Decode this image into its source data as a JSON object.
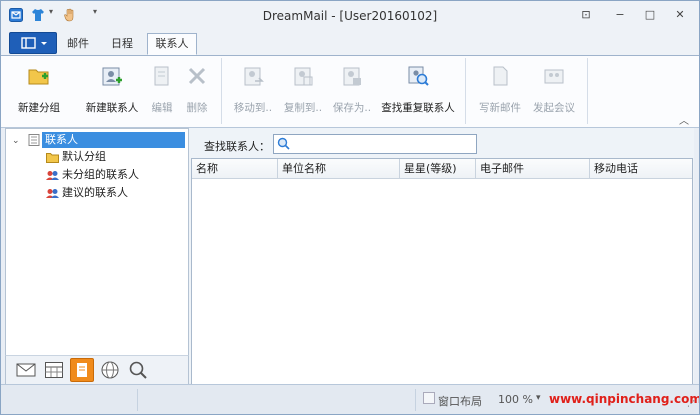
{
  "window": {
    "title": "DreamMail - [User20160102]"
  },
  "tabs": [
    {
      "label": "邮件"
    },
    {
      "label": "日程"
    },
    {
      "label": "联系人"
    }
  ],
  "ribbon": {
    "new_group": "新建分组",
    "new_contact": "新建联系人",
    "edit": "编辑",
    "delete": "删除",
    "move_to": "移动到..",
    "copy_to": "复制到..",
    "save_as": "保存为..",
    "find_duplicates": "查找重复联系人",
    "write_mail": "写新邮件",
    "start_meeting": "发起会议"
  },
  "tree": {
    "root": "联系人",
    "children": [
      {
        "label": "默认分组"
      },
      {
        "label": "未分组的联系人"
      },
      {
        "label": "建议的联系人"
      }
    ]
  },
  "search": {
    "label": "查找联系人：",
    "value": ""
  },
  "table": {
    "columns": [
      "名称",
      "单位名称",
      "星星(等级)",
      "电子邮件",
      "移动电话"
    ]
  },
  "status": {
    "window_layout": "窗口布局",
    "zoom": "100 %",
    "watermark": "www.qinpinchang.com"
  },
  "colors": {
    "accent": "#1f5fb8",
    "tree_selected": "#3b8ee0",
    "watermark": "#e0201a"
  }
}
